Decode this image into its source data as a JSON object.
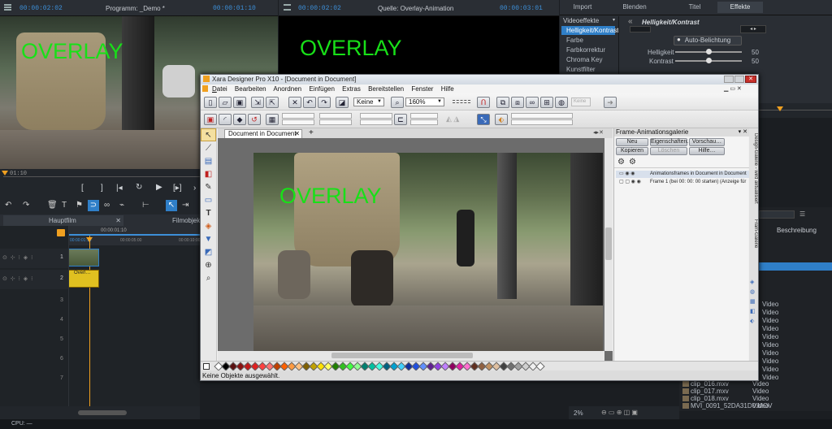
{
  "program_monitor": {
    "tc_left": "00:00:02:02",
    "title": "Programm: _Demo *",
    "tc_right": "00:00:01:10",
    "overlay": "OVERLAY",
    "scrub_time": "01:10"
  },
  "source_monitor": {
    "tc_left": "00:00:02:02",
    "title": "Quelle: Overlay-Animation",
    "tc_right": "00:00:03:01",
    "overlay": "OVERLAY"
  },
  "right_panel": {
    "tabs": [
      "Import",
      "Blenden",
      "Titel",
      "Effekte"
    ],
    "categories": [
      {
        "label": "Videoeffekte"
      },
      {
        "label": "Helligkeit/Kontrast"
      },
      {
        "label": "Farbe"
      },
      {
        "label": "Farbkorrektur"
      },
      {
        "label": "Chroma Key"
      },
      {
        "label": "Kunstfilter"
      }
    ],
    "effect_title": "Helligkeit/Kontrast",
    "auto_label": "Auto-Belichtung",
    "sliders": [
      {
        "label": "Helligkeit",
        "value": "50",
        "level": 0.5
      },
      {
        "label": "Kontrast",
        "value": "50",
        "level": 0.5
      }
    ]
  },
  "timeline": {
    "tabs": [
      "Hauptfilm",
      "Filmobjekt"
    ],
    "ruler": [
      "00:00:01:10",
      "00:00:05:00",
      "00:00:10:00"
    ],
    "ruler_small": "00:00:01:10",
    "tracks": [
      "1",
      "2",
      "3",
      "4",
      "5",
      "6",
      "7"
    ],
    "clip_label": "Overl…",
    "zoom": "2%",
    "status": "CPU: —"
  },
  "media_list": {
    "header": "Beschreibung",
    "items": [
      {
        "name": "clip_016.mxv",
        "type": "Video"
      },
      {
        "name": "clip_017.mxv",
        "type": "Video"
      },
      {
        "name": "clip_018.mxv",
        "type": "Video"
      },
      {
        "name": "MVI_0091_52DA31D0.MOV",
        "type": "Video"
      }
    ],
    "side_types": [
      "Video",
      "Video",
      "Video",
      "Video",
      "Video",
      "Video",
      "Video",
      "Video",
      "Video",
      "Video",
      "Video",
      "Video",
      "Video",
      "Video"
    ]
  },
  "xara": {
    "title": "Xara Designer Pro X10 - [Document in Document]",
    "menu": [
      "Datei",
      "Bearbeiten",
      "Anordnen",
      "Einfügen",
      "Extras",
      "Bereitstellen",
      "Fenster",
      "Hilfe"
    ],
    "quality": "Keine",
    "zoom": "160%",
    "tool_box": "Keine",
    "doc_tab": "Document in Document",
    "canvas_overlay": "OVERLAY",
    "status": "Keine Objekte ausgewählt.",
    "gallery": {
      "title": "Frame-Animationsgalerie",
      "buttons": [
        "Neu",
        "Eigenschaften…",
        "Vorschau…",
        "Kopieren",
        "Löschen",
        "Hilfe…"
      ],
      "rows": [
        "Animationsframes in Document in Document",
        "Frame 1 (bei 00: 00: 00 starten) (Anzeige für"
      ]
    },
    "side_tabs": [
      "Design-Galerie - wird aktualisiert",
      "Fram-Galerie"
    ],
    "palette": [
      "#ffffff",
      "#000000",
      "#5a1010",
      "#8a1010",
      "#c01818",
      "#e02020",
      "#ff4040",
      "#ff7070",
      "#c04000",
      "#ff6000",
      "#ff9a40",
      "#ffc080",
      "#806000",
      "#c0a000",
      "#ffe000",
      "#ffff60",
      "#208000",
      "#30c020",
      "#40ff40",
      "#90ff90",
      "#008070",
      "#00c0a0",
      "#40ffe0",
      "#006080",
      "#00a0d0",
      "#40d0ff",
      "#1030a0",
      "#2050e0",
      "#6090ff",
      "#602090",
      "#9040e0",
      "#c080ff",
      "#900060",
      "#e020a0",
      "#ff70d0",
      "#603020",
      "#906040",
      "#c09060",
      "#e0c0a0",
      "#404040",
      "#707070",
      "#a0a0a0",
      "#d0d0d0",
      "#f0f0f0",
      "#fafafa"
    ]
  }
}
